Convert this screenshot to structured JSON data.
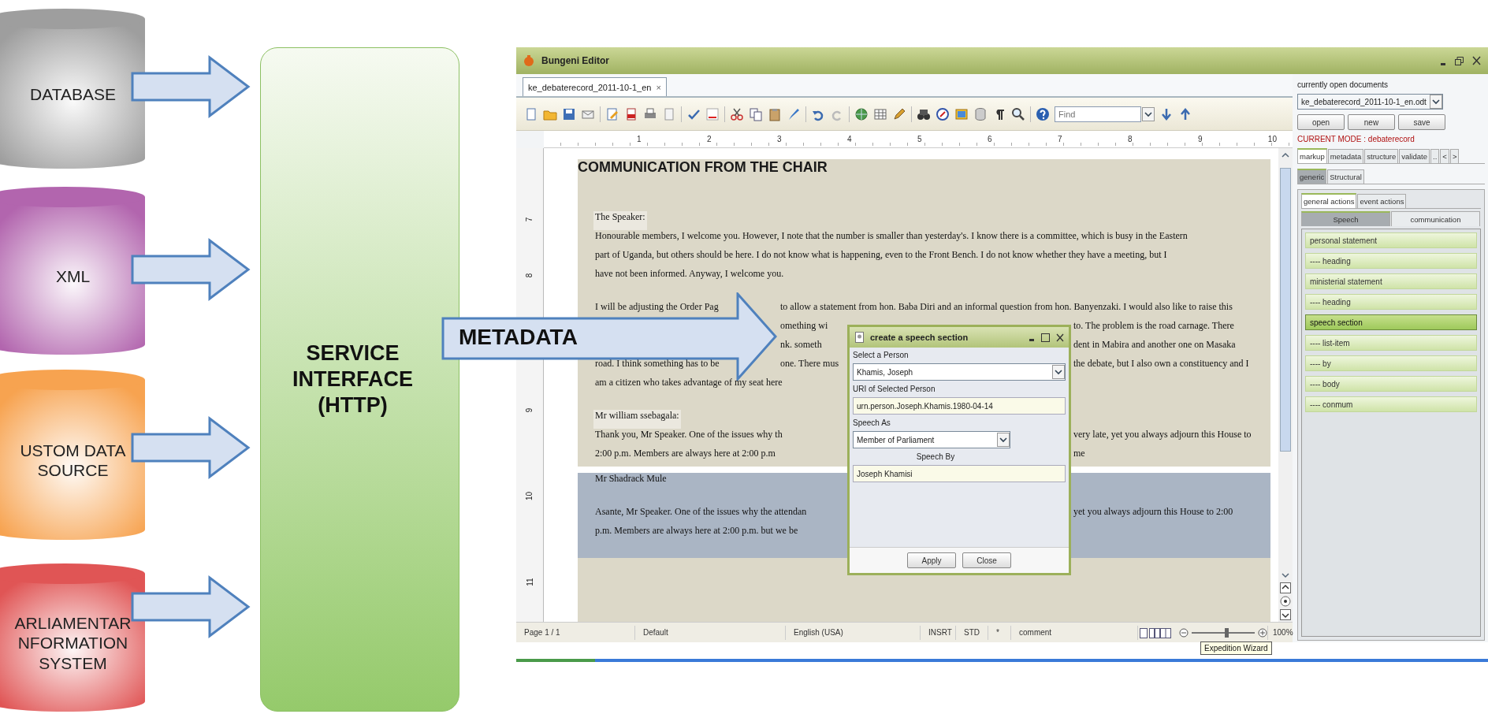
{
  "diagram": {
    "sources": [
      {
        "label_lines": [
          "DATABASE"
        ],
        "color": "#9e9e9e"
      },
      {
        "label_lines": [
          "XML"
        ],
        "color": "#b265ae"
      },
      {
        "label_lines": [
          "USTOM DATA",
          "SOURCE"
        ],
        "color": "#f7a350"
      },
      {
        "label_lines": [
          "ARLIAMENTAR",
          "NFORMATION",
          "SYSTEM"
        ],
        "color": "#e05555"
      }
    ],
    "service": {
      "label_lines": [
        "SERVICE",
        "INTERFACE",
        "(HTTP)"
      ]
    },
    "metadata_arrow": {
      "label": "METADATA"
    }
  },
  "editor": {
    "window": {
      "title": "Bungeni Editor"
    },
    "document_tab": {
      "label": "ke_debaterecord_2011-10-1_en",
      "close": "×"
    },
    "find": {
      "placeholder": "Find"
    },
    "ruler": {
      "labels": [
        "1",
        "2",
        "3",
        "4",
        "5",
        "6",
        "7",
        "8",
        "9",
        "10"
      ]
    },
    "vertical_ruler": {
      "labels": [
        "7",
        "8",
        "9",
        "10",
        "11"
      ]
    },
    "document": {
      "sections": [
        {
          "highlighted": false,
          "rows": [
            {
              "kind": "heading",
              "segments": [
                {
                  "kind": "full",
                  "text": "COMMUNICATION FROM THE CHAIR"
                }
              ]
            }
          ]
        },
        {
          "highlighted": false,
          "rows": [
            {
              "kind": "speaker",
              "segments": [
                {
                  "kind": "full",
                  "text": "The Speaker:"
                }
              ]
            },
            {
              "kind": "text",
              "segments": [
                {
                  "kind": "full",
                  "text": "Honourable members, I welcome you. However, I note that the number is smaller than yesterday's. I know there is a committee, which is busy in the Eastern"
                }
              ]
            },
            {
              "kind": "text",
              "segments": [
                {
                  "kind": "full",
                  "text": "part of Uganda, but others should be here. I do not know what is happening, even to the Front Bench. I do not know whether they have a meeting, but I"
                }
              ]
            },
            {
              "kind": "text",
              "segments": [
                {
                  "kind": "full",
                  "text": "have not been informed. Anyway, I welcome you."
                }
              ]
            },
            {
              "kind": "blank"
            },
            {
              "kind": "text",
              "segments": [
                {
                  "kind": "left",
                  "text": "I will be adjusting the Order Pag"
                },
                {
                  "kind": "midwide",
                  "text": "to allow a statement from hon. Baba Diri and an informal question from hon. Banyenzaki. I would also like to raise this"
                }
              ]
            },
            {
              "kind": "text",
              "segments": [
                {
                  "kind": "middle",
                  "text": "omething wi"
                },
                {
                  "kind": "right",
                  "text": "to. The problem is the road carnage. There"
                }
              ]
            },
            {
              "kind": "text",
              "segments": [
                {
                  "kind": "middle",
                  "text": "nk. someth"
                },
                {
                  "kind": "right",
                  "text": "dent in Mabira and another one on Masaka"
                }
              ]
            },
            {
              "kind": "text",
              "segments": [
                {
                  "kind": "left",
                  "text": "road. I think something has to be"
                },
                {
                  "kind": "middle",
                  "text": "one. There mus"
                },
                {
                  "kind": "right",
                  "text": "the debate, but I also own a constituency and I"
                }
              ]
            },
            {
              "kind": "text",
              "segments": [
                {
                  "kind": "leftwide",
                  "text": "am a citizen who takes advantage of my seat here"
                }
              ]
            },
            {
              "kind": "blank"
            }
          ]
        },
        {
          "highlighted": false,
          "rows": [
            {
              "kind": "speaker",
              "segments": [
                {
                  "kind": "full",
                  "text": "Mr william ssebagala:"
                }
              ]
            },
            {
              "kind": "text",
              "segments": [
                {
                  "kind": "leftwide",
                  "text": "Thank you, Mr Speaker. One of the issues why th"
                },
                {
                  "kind": "right",
                  "text": "very late, yet you always adjourn this House to"
                }
              ]
            },
            {
              "kind": "text",
              "segments": [
                {
                  "kind": "leftwide",
                  "text": "2:00 p.m. Members are always here at 2:00 p.m"
                },
                {
                  "kind": "right",
                  "text": "me"
                }
              ]
            }
          ]
        },
        {
          "highlighted": true,
          "rows": [
            {
              "kind": "text",
              "segments": [
                {
                  "kind": "full",
                  "text": "Mr Shadrack Mule"
                }
              ]
            },
            {
              "kind": "blank"
            },
            {
              "kind": "text",
              "segments": [
                {
                  "kind": "leftwide",
                  "text": "Asante, Mr Speaker. One of the issues why the attendan"
                },
                {
                  "kind": "right",
                  "text": "yet you always adjourn this House to 2:00"
                }
              ]
            },
            {
              "kind": "text",
              "segments": [
                {
                  "kind": "leftwide",
                  "text": "p.m. Members are always here at 2:00 p.m. but we be"
                }
              ]
            },
            {
              "kind": "blank"
            }
          ]
        }
      ]
    },
    "status_bar": {
      "page": "Page 1 / 1",
      "style": "Default",
      "language": "English (USA)",
      "insert_mode": "INSRT",
      "selection_mode": "STD",
      "modified": "*",
      "comment": "comment",
      "zoom_slider": {
        "level": 0.55
      },
      "zoom": "100%"
    },
    "tooltip": "Expedition Wizard",
    "dialog": {
      "title": "create a speech section",
      "person_label": "Select a Person",
      "person": "Khamis, Joseph",
      "uri_label": "URI of Selected Person",
      "uri": "urn.person.Joseph.Khamis.1980-04-14",
      "speech_as_label": "Speech As",
      "speech_as": "Member of Parliament",
      "speech_by_label": "Speech By",
      "speech_by": "Joseph Khamisi",
      "buttons": [
        "Apply",
        "Close"
      ]
    },
    "side_panel": {
      "documents_label": "currently open documents",
      "document": "ke_debaterecord_2011-10-1_en.odt",
      "buttons": [
        "open",
        "new",
        "save"
      ],
      "mode": "CURRENT MODE : debaterecord",
      "tabs": [
        {
          "label": "markup",
          "selected": true
        },
        {
          "label": "metadata",
          "selected": false
        },
        {
          "label": "structure",
          "selected": false
        },
        {
          "label": "validate",
          "selected": false
        },
        {
          "label": "..",
          "selected": false
        }
      ],
      "tab_scroll": [
        "<",
        ">"
      ],
      "subtabs": [
        {
          "label": "generic",
          "selected": true
        },
        {
          "label": "Structural",
          "selected": false
        }
      ],
      "action_tabs": [
        {
          "label": "general actions",
          "selected": true
        },
        {
          "label": "event actions",
          "selected": false
        }
      ],
      "category_tabs": [
        {
          "label": "Speech",
          "selected": true
        },
        {
          "label": "communication",
          "selected": false
        }
      ],
      "actions": [
        {
          "label": "personal statement",
          "selected": false
        },
        {
          "label": "---- heading",
          "selected": false
        },
        {
          "label": "ministerial statement",
          "selected": false
        },
        {
          "label": "---- heading",
          "selected": false
        },
        {
          "label": "speech section",
          "selected": true
        },
        {
          "label": "---- list-item",
          "selected": false
        },
        {
          "label": "---- by",
          "selected": false
        },
        {
          "label": "---- body",
          "selected": false
        },
        {
          "label": "---- conmum",
          "selected": false
        }
      ]
    }
  }
}
